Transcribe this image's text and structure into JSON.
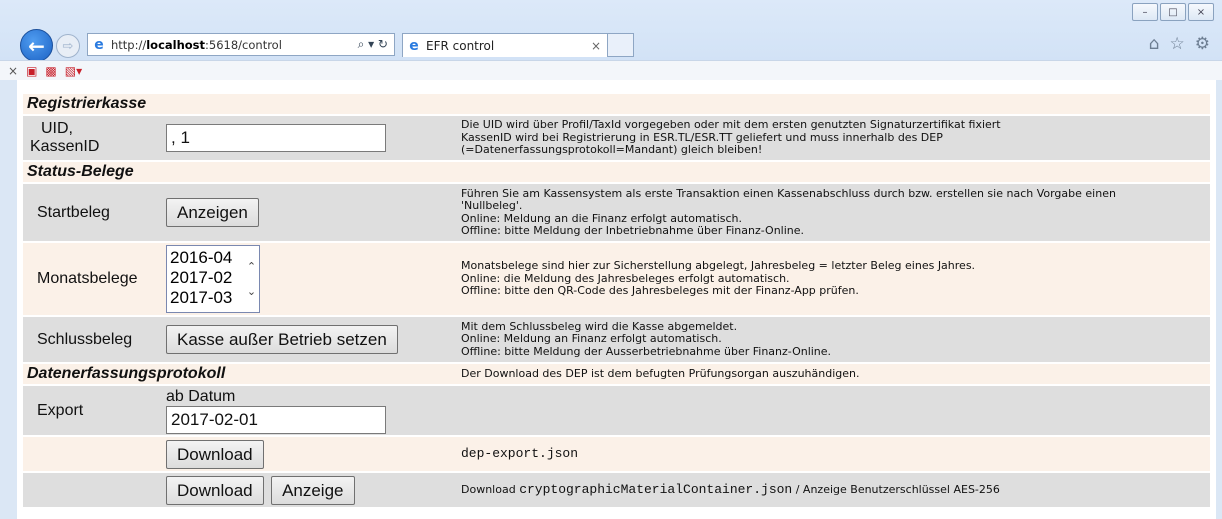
{
  "browser": {
    "url_prefix": "http://",
    "url_host": "localhost",
    "url_rest": ":5618/control",
    "address_tools": "⌕ ▾ ↻",
    "tab_title": "EFR control",
    "tab_close": "×",
    "window_controls": [
      "–",
      "□",
      "×"
    ]
  },
  "registrierkasse": {
    "heading": "Registrierkasse",
    "uid_label": "UID,\nKassenID",
    "uid_value": ", 1",
    "description": [
      "Die UID wird über Profil/TaxId vorgegeben oder mit dem ersten genutzten Signaturzertifikat fixiert",
      "KassenID wird bei Registrierung in ESR.TL/ESR.TT geliefert und muss innerhalb des DEP",
      "(=Datenerfassungsprotokoll=Mandant) gleich bleiben!"
    ]
  },
  "status_belege": {
    "heading": "Status-Belege",
    "startbeleg": {
      "label": "Startbeleg",
      "button": "Anzeigen",
      "description": [
        "Führen Sie am Kassensystem als erste Transaktion einen Kassenabschluss durch bzw. erstellen sie nach Vorgabe einen",
        "'Nullbeleg'.",
        "Online: Meldung an die Finanz erfolgt automatisch.",
        "Offline: bitte Meldung der Inbetriebnahme über Finanz-Online."
      ]
    },
    "monatsbelege": {
      "label": "Monatsbelege",
      "options": [
        "2016-04",
        "2017-02",
        "2017-03"
      ],
      "description": [
        "Monatsbelege sind hier zur Sicherstellung abgelegt, Jahresbeleg = letzter Beleg eines Jahres.",
        "Online: die Meldung des Jahresbeleges erfolgt automatisch.",
        "Offline: bitte den QR-Code des Jahresbeleges mit der Finanz-App prüfen."
      ]
    },
    "schlussbeleg": {
      "label": "Schlussbeleg",
      "button": "Kasse außer Betrieb setzen",
      "description": [
        "Mit dem Schlussbeleg wird die Kasse abgemeldet.",
        "Online: Meldung an Finanz erfolgt automatisch.",
        "Offline: bitte Meldung der Ausserbetriebnahme über Finanz-Online."
      ]
    }
  },
  "dep": {
    "heading": "Datenerfassungsprotokoll",
    "heading_description": "Der Download des DEP ist dem befugten Prüfungsorgan auszuhändigen.",
    "export_label": "Export",
    "date_label": "ab Datum",
    "date_value": "2017-02-01",
    "download_label": "Download",
    "export_file": "dep-export.json",
    "crypto_download_label": "Download",
    "anzeige_label": "Anzeige",
    "crypto_prefix": "Download ",
    "crypto_file": "cryptographicMaterialContainer.json",
    "crypto_suffix": " / Anzeige Benutzerschlüssel AES-256"
  }
}
